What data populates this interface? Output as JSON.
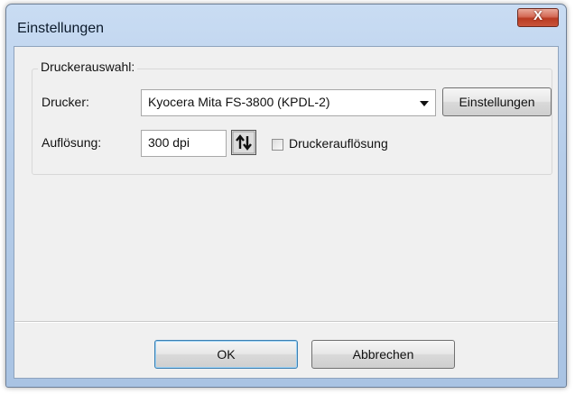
{
  "window": {
    "title": "Einstellungen",
    "close_label": "X"
  },
  "group": {
    "label": "Druckerauswahl:"
  },
  "printer": {
    "label": "Drucker:",
    "selected": "Kyocera Mita FS-3800 (KPDL-2)",
    "settings_button": "Einstellungen"
  },
  "resolution": {
    "label": "Auflösung:",
    "value": "300 dpi",
    "checkbox_label": "Druckerauflösung",
    "checked": false
  },
  "footer": {
    "ok_label": "OK",
    "cancel_label": "Abbrechen"
  }
}
